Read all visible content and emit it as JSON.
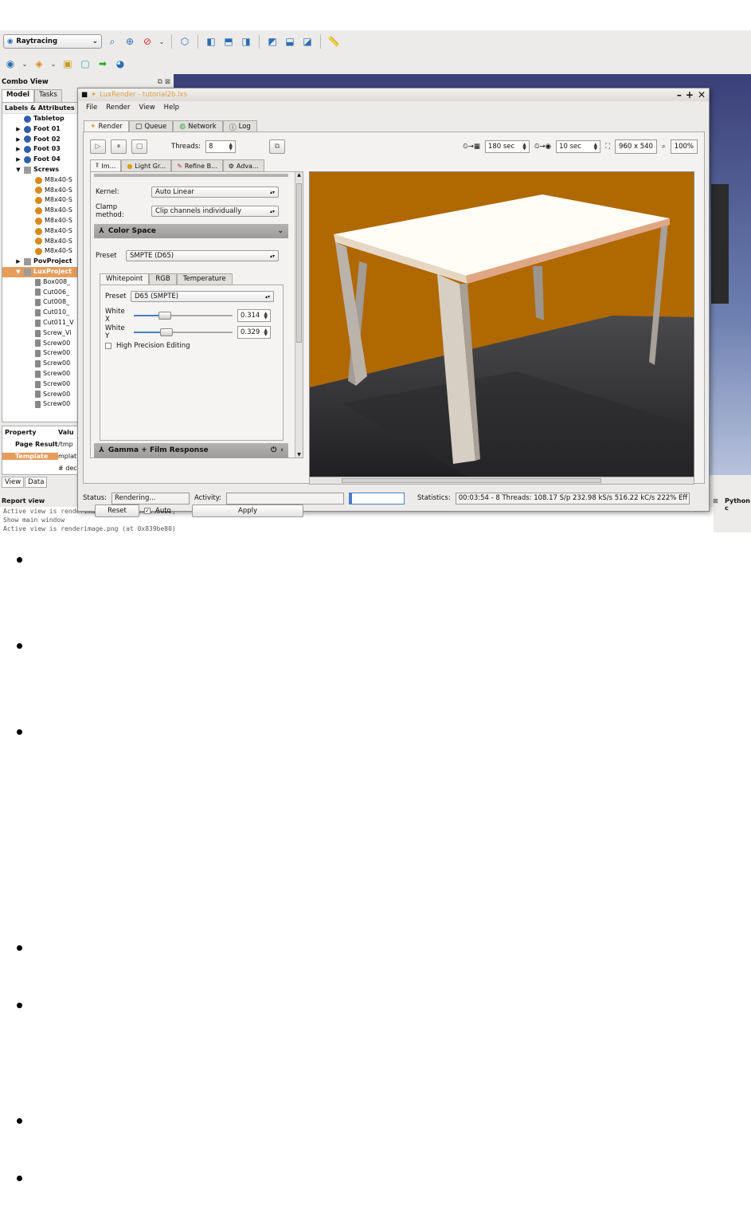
{
  "toolbar": {
    "workbench": "Raytracing",
    "icons_row1": [
      "zoom-fit-icon",
      "zoom-selection-icon",
      "draw-style-icon",
      "isometric-view-icon",
      "front-view-icon",
      "top-view-icon",
      "right-view-icon",
      "rear-view-icon",
      "bottom-view-icon",
      "left-view-icon",
      "measure-icon"
    ],
    "icons_row2": [
      "new-project-icon",
      "insert-part-icon",
      "export-icon",
      "render-icon",
      "lux-render-icon",
      "pov-icon"
    ]
  },
  "combo": {
    "title": "Combo View",
    "tabs": [
      "Model",
      "Tasks"
    ],
    "tree_header": "Labels & Attributes",
    "tree": [
      {
        "label": "Tabletop",
        "icon": "body",
        "expander": ""
      },
      {
        "label": "Foot 01",
        "icon": "body",
        "expander": "▶"
      },
      {
        "label": "Foot 02",
        "icon": "body",
        "expander": "▶"
      },
      {
        "label": "Foot 03",
        "icon": "body",
        "expander": "▶"
      },
      {
        "label": "Foot 04",
        "icon": "body",
        "expander": "▶"
      },
      {
        "label": "Screws",
        "icon": "folder",
        "expander": "▼"
      },
      {
        "label": "M8x40-S",
        "icon": "screw",
        "expander": ""
      },
      {
        "label": "M8x40-S",
        "icon": "screw",
        "expander": ""
      },
      {
        "label": "M8x40-S",
        "icon": "screw",
        "expander": ""
      },
      {
        "label": "M8x40-S",
        "icon": "screw",
        "expander": ""
      },
      {
        "label": "M8x40-S",
        "icon": "screw",
        "expander": ""
      },
      {
        "label": "M8x40-S",
        "icon": "screw",
        "expander": ""
      },
      {
        "label": "M8x40-S",
        "icon": "screw",
        "expander": ""
      },
      {
        "label": "M8x40-S",
        "icon": "screw",
        "expander": ""
      },
      {
        "label": "PovProject",
        "icon": "folder",
        "expander": "▶"
      },
      {
        "label": "LuxProject",
        "icon": "folder",
        "expander": "▼",
        "selected": true
      },
      {
        "label": "Box008_",
        "icon": "feat",
        "expander": ""
      },
      {
        "label": "Cut006_",
        "icon": "feat",
        "expander": ""
      },
      {
        "label": "Cut008_",
        "icon": "feat",
        "expander": ""
      },
      {
        "label": "Cut010_",
        "icon": "feat",
        "expander": ""
      },
      {
        "label": "Cut011_V",
        "icon": "feat",
        "expander": ""
      },
      {
        "label": "Screw_Vi",
        "icon": "feat",
        "expander": ""
      },
      {
        "label": "Screw00",
        "icon": "feat",
        "expander": ""
      },
      {
        "label": "Screw00",
        "icon": "feat",
        "expander": ""
      },
      {
        "label": "Screw00",
        "icon": "feat",
        "expander": ""
      },
      {
        "label": "Screw00",
        "icon": "feat",
        "expander": ""
      },
      {
        "label": "Screw00",
        "icon": "feat",
        "expander": ""
      },
      {
        "label": "Screw00",
        "icon": "feat",
        "expander": ""
      },
      {
        "label": "Screw00",
        "icon": "feat",
        "expander": ""
      }
    ],
    "property_header": "Property",
    "value_header": "Valu",
    "properties": [
      {
        "key": "Page Result",
        "value": "/tmp"
      },
      {
        "key": "Template",
        "value": "mplat",
        "selected": true
      },
      {
        "key": "",
        "value": "# dec"
      }
    ],
    "view_tab": "View",
    "data_tab": "Data"
  },
  "report": {
    "title": "Report view",
    "lines": [
      "Active view is renderimage.png (at 0x839be80)",
      "Show main window",
      "Active view is renderimage.png (at 0x839be80)"
    ]
  },
  "python_title": "Python c",
  "lux": {
    "title": "LuxRender - tutorial2b.lxs",
    "menu": [
      "File",
      "Render",
      "View",
      "Help"
    ],
    "tabs": [
      "Render",
      "Queue",
      "Network",
      "Log"
    ],
    "threads_label": "Threads:",
    "threads_value": "8",
    "halt_time": "180 sec",
    "refresh_time": "10 sec",
    "resolution": "960 x 540",
    "zoom": "100%",
    "subtabs": [
      "Im...",
      "Light Gr...",
      "Refine B...",
      "Adva..."
    ],
    "kernel_label": "Kernel:",
    "kernel_value": "Auto Linear",
    "clamp_label": "Clamp method:",
    "clamp_value": "Clip channels individually",
    "color_space_title": "Color Space",
    "preset_label": "Preset",
    "preset_value": "SMPTE (D65)",
    "wp_tabs": [
      "Whitepoint",
      "RGB",
      "Temperature"
    ],
    "wp_preset_label": "Preset",
    "wp_preset_value": "D65 (SMPTE)",
    "white_x_label": "White X",
    "white_x_value": "0.314",
    "white_x_level": 0.314,
    "white_y_label": "White Y",
    "white_y_value": "0.329",
    "white_y_level": 0.329,
    "high_precision_label": "High Precision Editing",
    "gamma_title": "Gamma + Film Response",
    "reset_label": "Reset",
    "auto_label": "Auto",
    "apply_label": "Apply",
    "status_label": "Status:",
    "status_value": "Rendering...",
    "activity_label": "Activity:",
    "activity_value": "",
    "progress": 0.04,
    "statistics_label": "Statistics:",
    "statistics_value": "00:03:54 - 8 Threads: 108.17 S/p 232.98 kS/s 516.22 kC/s 222% Eff"
  },
  "colors": {
    "selection": "#e59d5c",
    "accent": "#4a7cc6",
    "render_bg": "#b86b00"
  }
}
